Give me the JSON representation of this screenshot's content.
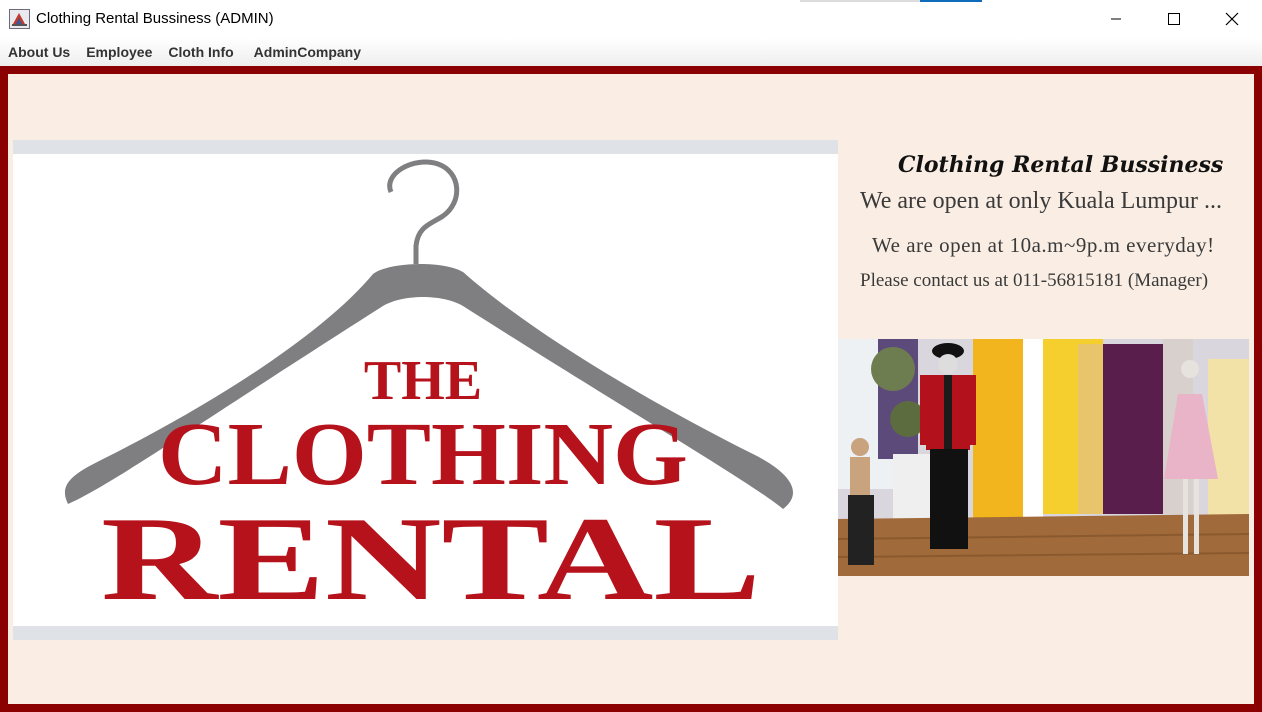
{
  "window": {
    "title": "Clothing Rental Bussiness (ADMIN)"
  },
  "menu": {
    "items": [
      {
        "label": "About Us"
      },
      {
        "label": "Employee"
      },
      {
        "label": "Cloth Info"
      },
      {
        "label": "AdminCompany"
      }
    ]
  },
  "logo": {
    "line1": "THE",
    "line2": "CLOTHING",
    "line3": "RENTAL",
    "text_color": "#b5121b",
    "hanger_color": "#7f7f82"
  },
  "info": {
    "business_name": "Clothing Rental Bussiness",
    "location": "We are open at only Kuala Lumpur ...",
    "hours": "We are open at 10a.m~9p.m everyday!",
    "contact": "Please contact us at 011-56815181 (Manager)"
  },
  "colors": {
    "frame": "#8b0000",
    "panel": "#faeee4"
  }
}
